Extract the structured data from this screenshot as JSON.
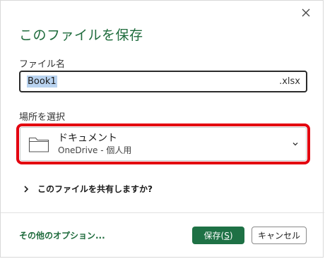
{
  "dialog": {
    "title": "このファイルを保存",
    "close_icon": "close-icon"
  },
  "filename": {
    "label": "ファイル名",
    "value": "Book1",
    "extension": ".xlsx"
  },
  "location": {
    "label": "場所を選択",
    "folder_icon": "folder-icon",
    "name": "ドキュメント",
    "sub": "OneDrive - 個人用",
    "dropdown_icon": "chevron-down-icon",
    "highlight_color": "#e3000f"
  },
  "share": {
    "icon": "chevron-right-icon",
    "label": "このファイルを共有しますか?"
  },
  "footer": {
    "more_options": "その他のオプション...",
    "save_prefix": "保存(",
    "save_accel": "S",
    "save_suffix": ")",
    "cancel": "キャンセル"
  },
  "colors": {
    "accent": "#1e6b3c",
    "save_button": "#1e7145",
    "selection": "#b9d3f0"
  }
}
